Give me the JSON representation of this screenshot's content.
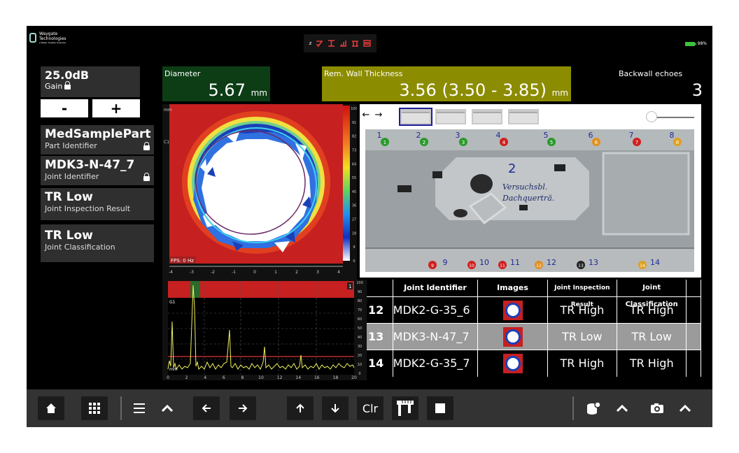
{
  "brand": {
    "line1": "Waygate",
    "line2": "Technologies",
    "line3": "A Baker Hughes business"
  },
  "topbar": {
    "mode_zone": "z",
    "battery": "98%"
  },
  "gain": {
    "value": "25.0dB",
    "label": "Gain",
    "minus": "-",
    "plus": "+"
  },
  "part": {
    "value": "MedSamplePart",
    "label": "Part Identifier"
  },
  "joint": {
    "value": "MDK3-N-47_7",
    "label": "Joint Identifier"
  },
  "inspection": {
    "value": "TR Low",
    "label": "Joint Inspection Result"
  },
  "classification": {
    "value": "TR Low",
    "label": "Joint Classification"
  },
  "metrics": {
    "diameter": {
      "label": "Diameter",
      "value": "5.67",
      "unit": "mm"
    },
    "wall": {
      "label": "Rem. Wall Thickness",
      "value": "3.56 (3.50 - 3.85)",
      "unit": "mm"
    },
    "backwall": {
      "label": "Backwall echoes",
      "value": "3"
    }
  },
  "cscan": {
    "fps": "FPS: 0 Hz",
    "mm": "mm",
    "gate": "C1",
    "x_ticks": [
      "-4",
      "-3",
      "-2",
      "-1",
      "0",
      "1",
      "2",
      "3",
      "4"
    ],
    "color_ticks": [
      "100",
      "91",
      "82",
      "73",
      "64",
      "55",
      "45",
      "36",
      "27",
      "18",
      "9",
      "0"
    ]
  },
  "ascan": {
    "gate": "G1",
    "mm": "mm",
    "x_ticks": [
      "0",
      "2",
      "4",
      "6",
      "8",
      "10",
      "12",
      "14",
      "16",
      "18",
      "20"
    ],
    "y_ticks": [
      "100",
      "90",
      "80",
      "70",
      "60",
      "50",
      "40",
      "30",
      "20",
      "10",
      "0"
    ],
    "cursor": "1"
  },
  "photo": {
    "nav_back": "←",
    "nav_forward": "→",
    "top_markers": [
      "1",
      "2",
      "3",
      "4",
      "5",
      "6",
      "7",
      "8"
    ],
    "bottom_markers": [
      "9",
      "10",
      "11",
      "12",
      "13",
      "14"
    ],
    "handwriting": [
      "Versuchsbl.",
      "Dachquerträ."
    ],
    "digit_z": "2"
  },
  "table": {
    "headers": [
      "",
      "Joint Identifier",
      "Images",
      "Joint Inspection Result",
      "Joint Classification",
      ""
    ],
    "rows": [
      {
        "num": "12",
        "id": "MDK2-G-35_6",
        "result": "TR High",
        "class": "TR High"
      },
      {
        "num": "13",
        "id": "MDK3-N-47_7",
        "result": "TR Low",
        "class": "TR Low"
      },
      {
        "num": "14",
        "id": "MDK2-G-35_7",
        "result": "TR High",
        "class": "TR High"
      }
    ]
  },
  "toolbar": {
    "clr": "Clr"
  },
  "icons": [
    "home-icon",
    "grid-icon",
    "menu-icon",
    "chevron-up-icon",
    "arrow-left-icon",
    "arrow-right-icon",
    "arrow-up-icon",
    "arrow-down-icon",
    "caliper-icon",
    "stop-icon",
    "settings-db-icon",
    "camera-icon",
    "lock-icon",
    "battery-icon"
  ],
  "colors": {
    "diameter_bg": "#0c3d15",
    "wall_bg": "#8c8c00",
    "selected_row": "#9b9b9b",
    "battery": "#3ec23e",
    "mode_icons": "#e53b3b"
  }
}
